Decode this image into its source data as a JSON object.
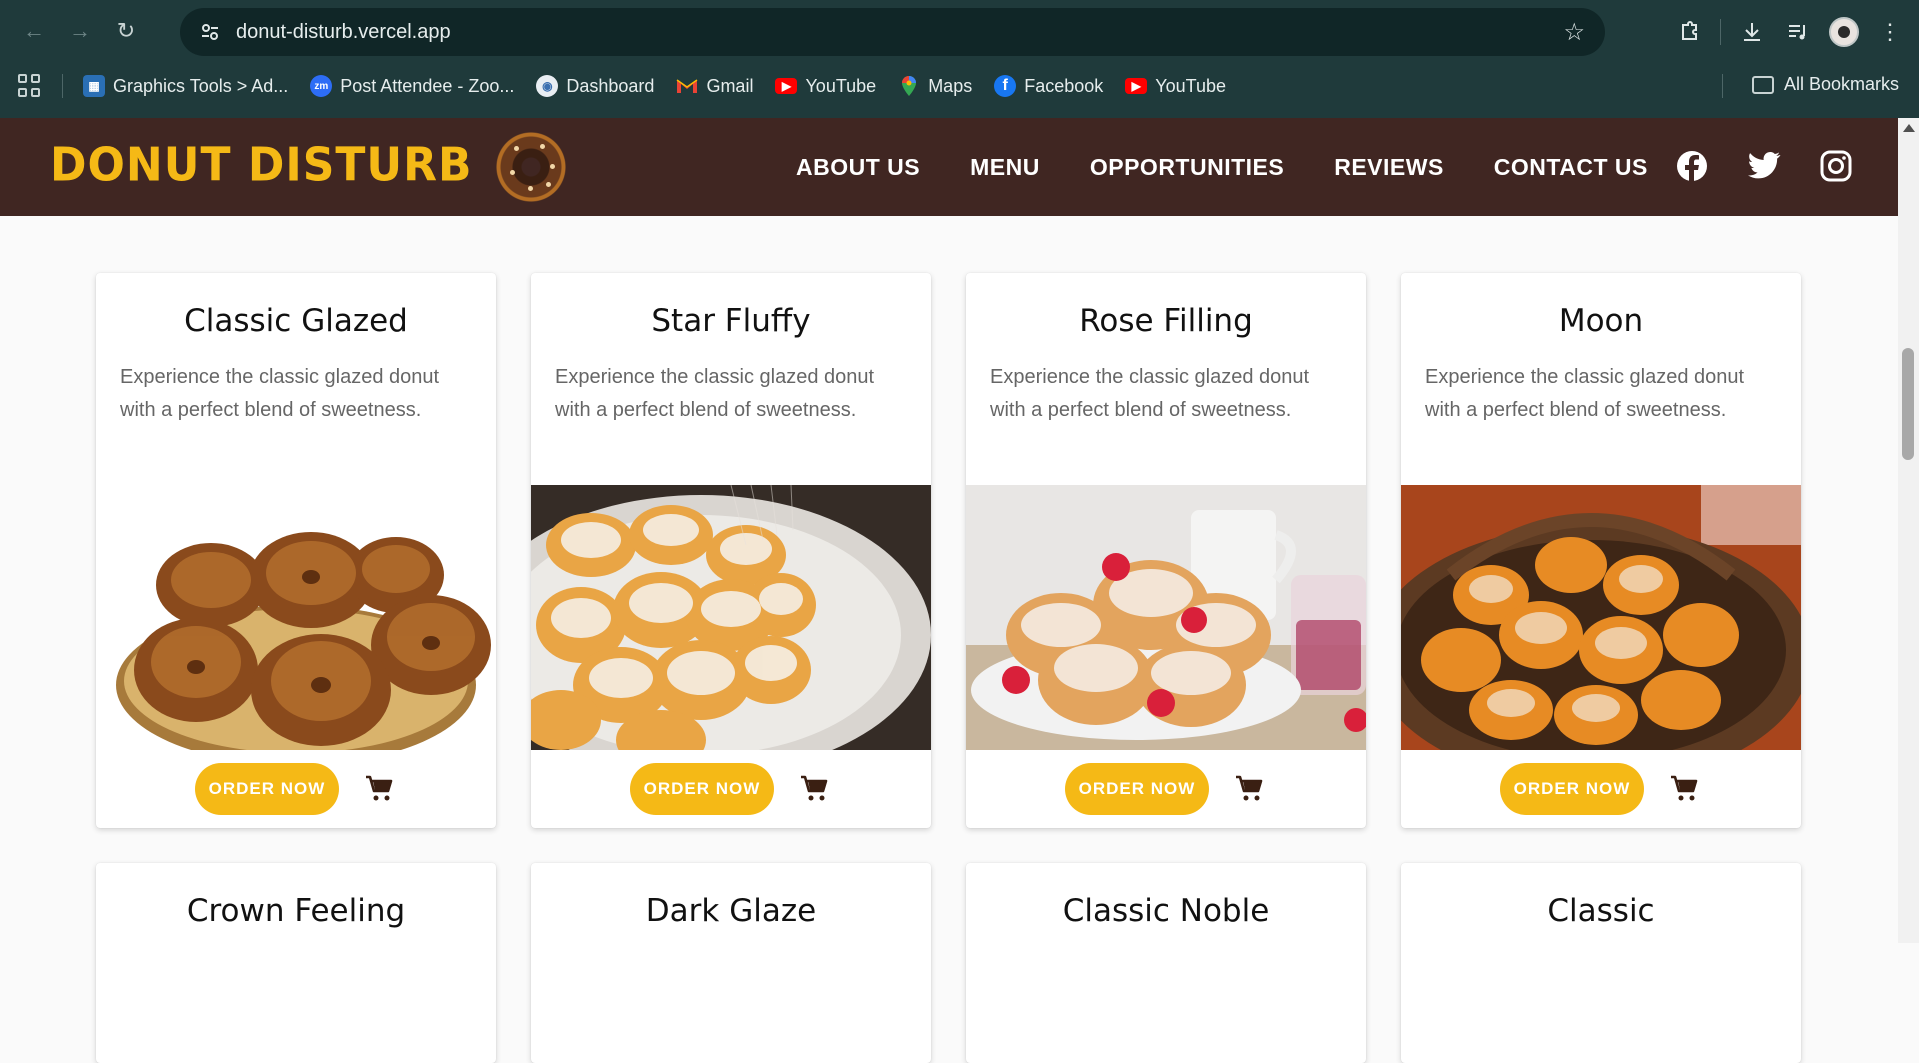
{
  "browser": {
    "url": "donut-disturb.vercel.app",
    "bookmarks": [
      {
        "label": "Graphics Tools > Ad...",
        "icon": "graphics-tools-favicon"
      },
      {
        "label": "Post Attendee - Zoo...",
        "icon": "zoom-favicon"
      },
      {
        "label": "Dashboard",
        "icon": "dashboard-favicon"
      },
      {
        "label": "Gmail",
        "icon": "gmail-favicon"
      },
      {
        "label": "YouTube",
        "icon": "youtube-favicon"
      },
      {
        "label": "Maps",
        "icon": "maps-favicon"
      },
      {
        "label": "Facebook",
        "icon": "facebook-favicon"
      },
      {
        "label": "YouTube",
        "icon": "youtube-favicon"
      }
    ],
    "all_bookmarks": "All Bookmarks"
  },
  "site": {
    "logo": "DONUT DISTURB",
    "nav": [
      "ABOUT US",
      "MENU",
      "OPPORTUNITIES",
      "REVIEWS",
      "CONTACT US"
    ],
    "social": [
      "facebook-icon",
      "twitter-icon",
      "instagram-icon"
    ],
    "colors": {
      "header_bg": "#402622",
      "accent": "#f5b916"
    }
  },
  "cards": [
    {
      "title": "Classic Glazed",
      "description": "Experience the classic glazed donut with a perfect blend of sweetness.",
      "button": "ORDER NOW"
    },
    {
      "title": "Star Fluffy",
      "description": "Experience the classic glazed donut with a perfect blend of sweetness.",
      "button": "ORDER NOW"
    },
    {
      "title": "Rose Filling",
      "description": "Experience the classic glazed donut with a perfect blend of sweetness.",
      "button": "ORDER NOW"
    },
    {
      "title": "Moon",
      "description": "Experience the classic glazed donut with a perfect blend of sweetness.",
      "button": "ORDER NOW"
    },
    {
      "title": "Crown Feeling"
    },
    {
      "title": "Dark Glaze"
    },
    {
      "title": "Classic Noble"
    },
    {
      "title": "Classic"
    }
  ]
}
